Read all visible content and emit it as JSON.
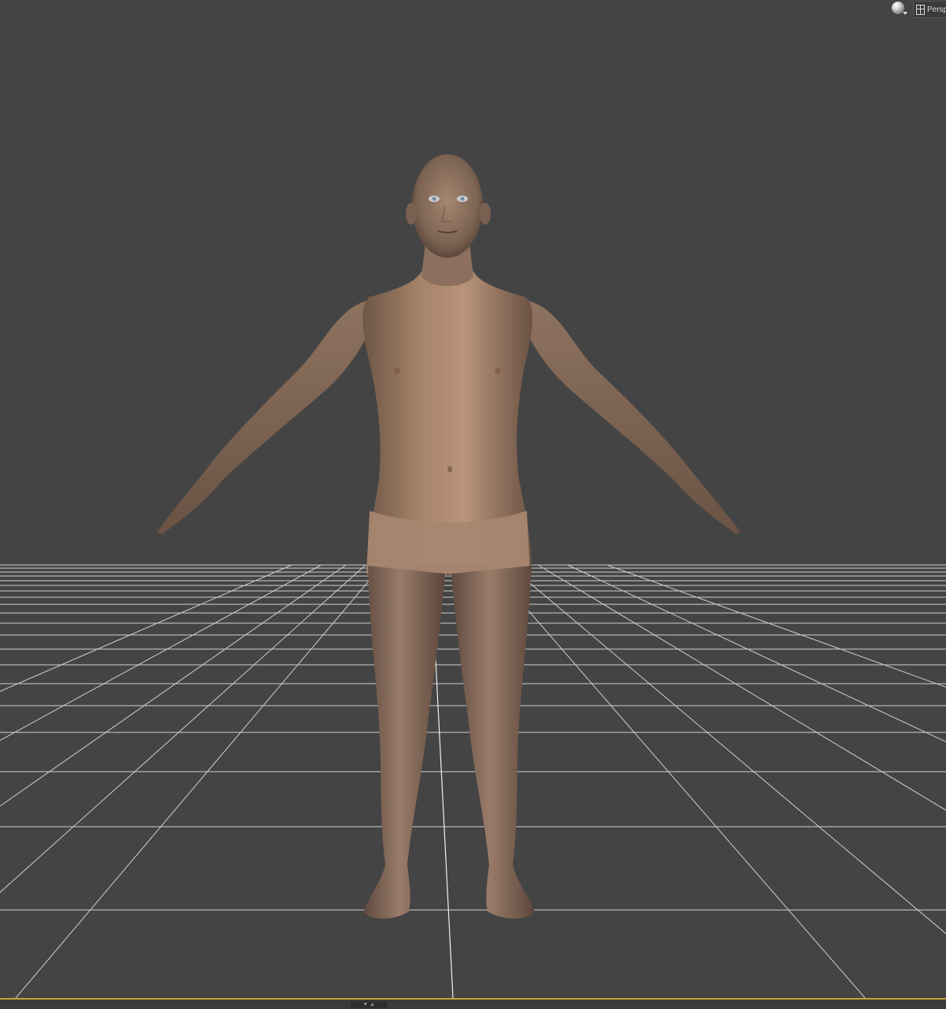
{
  "viewport": {
    "background_color": "#444444",
    "grid_line_color": "#d0d0d0",
    "center_line_color": "#f2f2f2"
  },
  "toolbar": {
    "render_mode_icon": "sphere-icon",
    "camera_label": "Perspective View",
    "camera_icon": "viewport-camera-icon"
  },
  "timeline_bar": {
    "accent_color": "#c8a23a",
    "handle_icon": "collapse-expand-icon"
  },
  "scene": {
    "skin_color": "#b08c6c"
  }
}
